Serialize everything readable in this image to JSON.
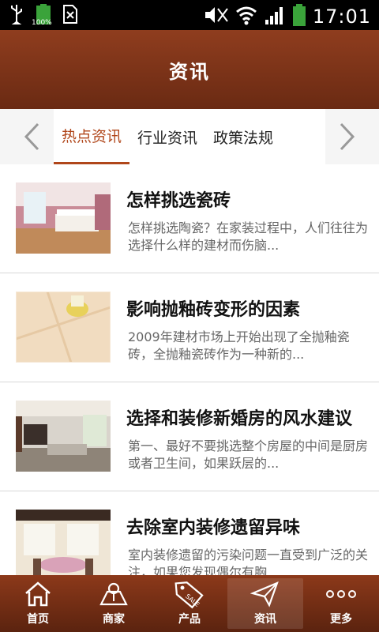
{
  "status_bar": {
    "battery_small_label": "100%",
    "time": "17:01",
    "icons": [
      "usb-icon",
      "battery-icon",
      "sim-icon",
      "mute-icon",
      "wifi-icon",
      "signal-icon",
      "battery-full-icon"
    ]
  },
  "header": {
    "title": "资讯"
  },
  "tabs": [
    {
      "label": "热点资讯",
      "active": true
    },
    {
      "label": "行业资讯",
      "active": false
    },
    {
      "label": "政策法规",
      "active": false
    }
  ],
  "articles": [
    {
      "title": "怎样挑选瓷砖",
      "summary": "怎样挑选陶瓷？在家装过程中，人们往往为选择什么样的建材而伤脑..."
    },
    {
      "title": "影响抛釉砖变形的因素",
      "summary": "2009年建材市场上开始出现了全抛釉瓷砖，全抛釉瓷砖作为一种新的..."
    },
    {
      "title": "选择和装修新婚房的风水建议",
      "summary": "第一、最好不要挑选整个房屋的中间是厨房或者卫生间，如果跃层的..."
    },
    {
      "title": "去除室内装修遗留异味",
      "summary": "室内装修遗留的污染问题一直受到广泛的关注，如果您发现偶尔有胸..."
    }
  ],
  "bottom_nav": [
    {
      "label": "首页",
      "icon": "home-icon",
      "active": false
    },
    {
      "label": "商家",
      "icon": "merchant-icon",
      "active": false
    },
    {
      "label": "产品",
      "icon": "sale-tag-icon",
      "active": false
    },
    {
      "label": "资讯",
      "icon": "send-icon",
      "active": true
    },
    {
      "label": "更多",
      "icon": "more-icon",
      "active": false
    }
  ],
  "colors": {
    "accent": "#b0461a",
    "header": "#7a3218"
  }
}
